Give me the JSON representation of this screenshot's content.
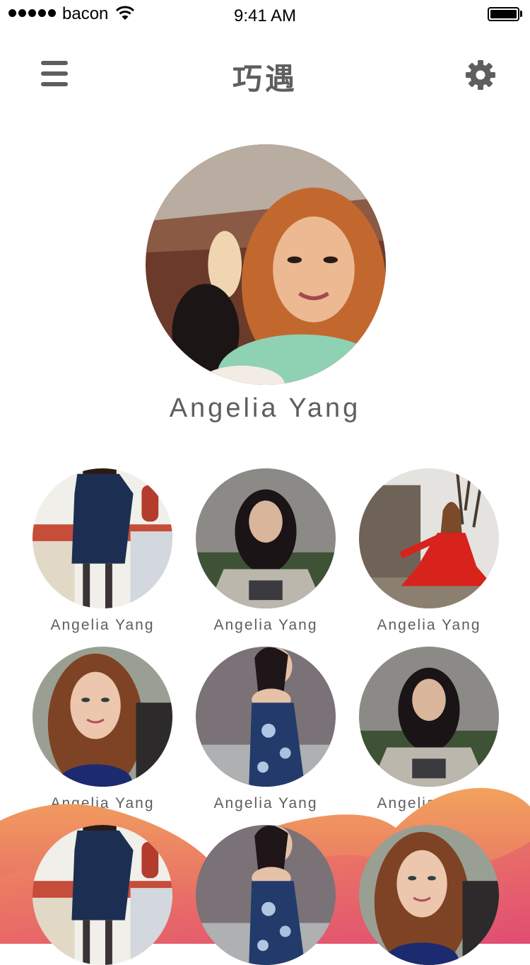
{
  "status_bar": {
    "carrier": "bacon",
    "time": "9:41 AM"
  },
  "nav": {
    "title": "巧遇",
    "menu_icon": "hamburger-icon",
    "settings_icon": "gear-icon"
  },
  "profile": {
    "name": "Angelia Yang"
  },
  "people": [
    {
      "name": "Angelia Yang",
      "photo": "navy-dress-kitchen"
    },
    {
      "name": "Angelia Yang",
      "photo": "grey-shirt-outdoor"
    },
    {
      "name": "Angelia Yang",
      "photo": "red-dress-stone-wall"
    },
    {
      "name": "Angelia Yang",
      "photo": "auburn-hair-smile"
    },
    {
      "name": "Angelia Yang",
      "photo": "floral-dress-hedge"
    },
    {
      "name": "Angelia Yang",
      "photo": "grey-shirt-outdoor"
    },
    {
      "name": "",
      "photo": "navy-dress-kitchen"
    },
    {
      "name": "",
      "photo": "floral-dress-hedge"
    },
    {
      "name": "",
      "photo": "auburn-hair-smile"
    }
  ],
  "colors": {
    "text": "#5e5e5e",
    "wave_orange": "#f2a25d",
    "wave_pink": "#e2527a"
  }
}
